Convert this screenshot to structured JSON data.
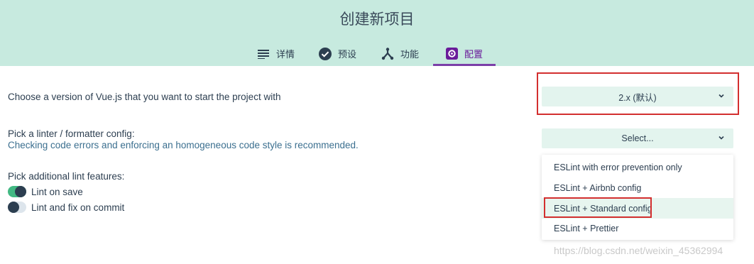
{
  "header": {
    "title": "创建新项目",
    "tabs": [
      {
        "label": "详情",
        "icon": "list-icon"
      },
      {
        "label": "预设",
        "icon": "check-circle-icon"
      },
      {
        "label": "功能",
        "icon": "fork-icon"
      },
      {
        "label": "配置",
        "icon": "settings-icon",
        "active": true
      }
    ]
  },
  "vue_version": {
    "label": "Choose a version of Vue.js that you want to start the project with",
    "selected": "2.x (默认)"
  },
  "linter": {
    "label": "Pick a linter / formatter config:",
    "description": "Checking code errors and enforcing an homogeneous code style is recommended.",
    "placeholder": "Select...",
    "options": [
      "ESLint with error prevention only",
      "ESLint + Airbnb config",
      "ESLint + Standard config",
      "ESLint + Prettier"
    ],
    "highlighted_index": 2
  },
  "lint_features": {
    "label": "Pick additional lint features:",
    "items": [
      {
        "label": "Lint on save",
        "enabled": true
      },
      {
        "label": "Lint and fix on commit",
        "enabled": false
      }
    ]
  },
  "watermark": "https://blog.csdn.net/weixin_45362994",
  "colors": {
    "header_bg": "#c7eadf",
    "accent_purple": "#7b3fa8",
    "toggle_on": "#42b983",
    "highlight_red": "#d32f2f"
  }
}
